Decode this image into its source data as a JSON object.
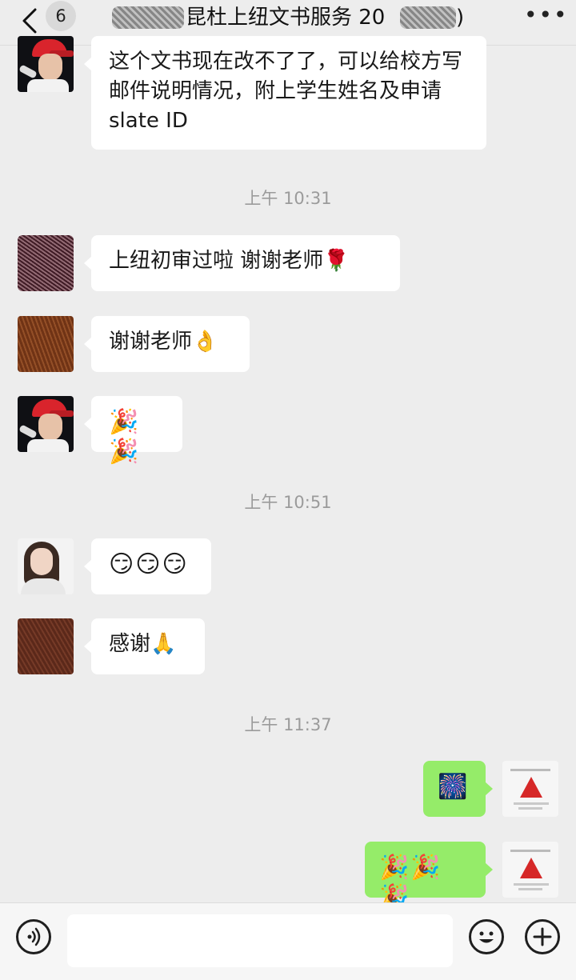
{
  "header": {
    "unread_count": "6",
    "title": "昆杜上纽文书服务 20",
    "title_tail": ")",
    "more_label": "•••"
  },
  "messages": [
    {
      "text": "这个文书现在改不了了，可以给校方写邮件说明情况，附上学生姓名及申请 slate ID"
    },
    {
      "time": "上午 10:31"
    },
    {
      "text": "上纽初审过啦 谢谢老师🌹"
    },
    {
      "text": "谢谢老师👌"
    },
    {
      "text": "🎉🎉"
    },
    {
      "time": "上午 10:51"
    },
    {
      "text": "😏😏😏"
    },
    {
      "text": "感谢🙏"
    },
    {
      "time": "上午 11:37"
    },
    {
      "text": "🎆"
    },
    {
      "text": "🎉🎉🎉"
    }
  ],
  "icons": {
    "back": "chevron-left-icon",
    "more": "more-icon",
    "voice": "voice-icon",
    "emoji": "emoji-icon",
    "plus": "plus-icon"
  },
  "colors": {
    "background": "#ededed",
    "incoming_bubble": "#ffffff",
    "outgoing_bubble": "#95ec69",
    "timestamp": "#9b9b9b"
  }
}
